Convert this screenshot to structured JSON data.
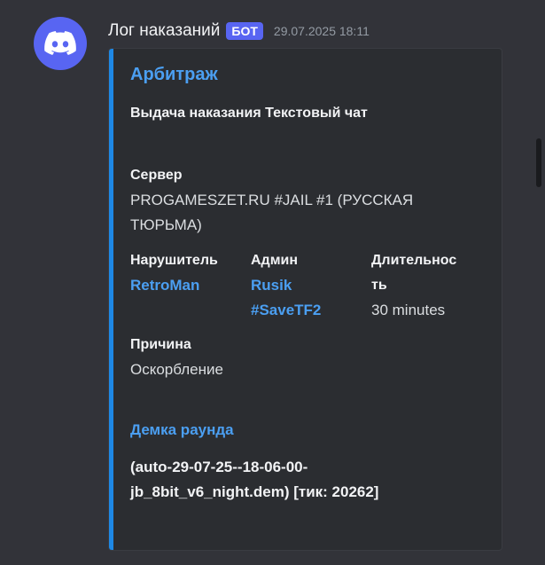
{
  "message": {
    "author": "Лог наказаний",
    "badge": "БОТ",
    "timestamp": "29.07.2025 18:11",
    "avatar_icon": "discord-logo-icon"
  },
  "embed": {
    "accent_color": "#1e88e5",
    "title": "Арбитраж",
    "description": "Выдача наказания Текстовый чат",
    "fields": {
      "server": {
        "name": "Сервер",
        "value_line1": "PROGAMESZET.RU #JAIL #1 (РУССКАЯ",
        "value_line2": "ТЮРЬМА)"
      },
      "offender": {
        "name": "Нарушитель",
        "value": "RetroMan"
      },
      "admin": {
        "name": "Админ",
        "value_line1": "Rusik",
        "value_line2": "#SaveTF2"
      },
      "duration": {
        "name_line1": "Длительнос",
        "name_line2": "ть",
        "value": "30 minutes"
      },
      "reason": {
        "name": "Причина",
        "value": "Оскорбление"
      }
    },
    "demo": {
      "title": "Демка раунда",
      "line1": "(auto-29-07-25--18-06-00-",
      "line2": "jb_8bit_v6_night.dem) [тик: 20262]"
    }
  }
}
